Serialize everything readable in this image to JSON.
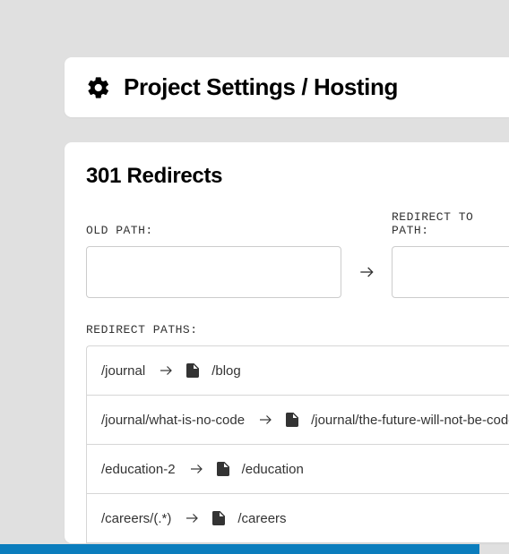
{
  "header": {
    "title": "Project Settings / Hosting"
  },
  "section": {
    "title": "301 Redirects",
    "old_path_label": "OLD PATH:",
    "redirect_to_label": "REDIRECT TO PATH:",
    "list_label": "REDIRECT PATHS:",
    "old_path_value": "",
    "redirect_to_value": ""
  },
  "redirects": [
    {
      "from": "/journal",
      "to": "/blog"
    },
    {
      "from": "/journal/what-is-no-code",
      "to": "/journal/the-future-will-not-be-coded"
    },
    {
      "from": "/education-2",
      "to": "/education"
    },
    {
      "from": "/careers/(.*)",
      "to": "/careers"
    }
  ]
}
